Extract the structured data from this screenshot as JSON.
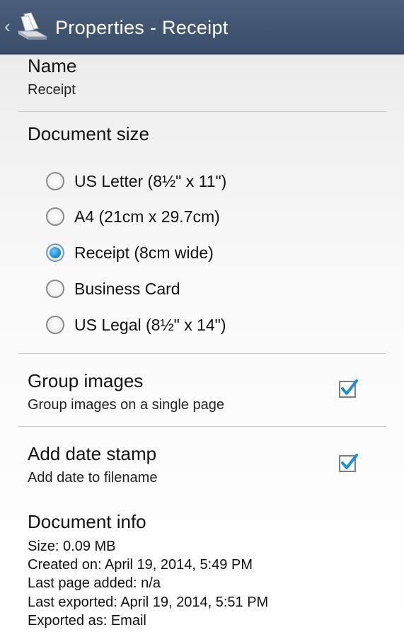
{
  "actionbar": {
    "title": "Properties - Receipt",
    "up_icon": "chevron-left-icon",
    "app_icon": "scanner-icon"
  },
  "name": {
    "label": "Name",
    "value": "Receipt"
  },
  "document_size": {
    "label": "Document size",
    "options": [
      {
        "label": "US Letter (8½\" x 11\")",
        "selected": false
      },
      {
        "label": "A4 (21cm x 29.7cm)",
        "selected": false
      },
      {
        "label": "Receipt (8cm wide)",
        "selected": true
      },
      {
        "label": "Business Card",
        "selected": false
      },
      {
        "label": "US Legal (8½\" x 14\")",
        "selected": false
      }
    ]
  },
  "group_images": {
    "label": "Group images",
    "description": "Group images on a single page",
    "checked": true
  },
  "date_stamp": {
    "label": "Add date stamp",
    "description": "Add date to filename",
    "checked": true
  },
  "document_info": {
    "label": "Document info",
    "lines": [
      "Size: 0.09 MB",
      "Created on: April 19, 2014, 5:49 PM",
      "Last page added: n/a",
      "Last exported: April 19, 2014, 5:51 PM",
      "Exported as: Email"
    ]
  },
  "colors": {
    "actionbar": "#435875",
    "accent": "#1a8ee0"
  }
}
